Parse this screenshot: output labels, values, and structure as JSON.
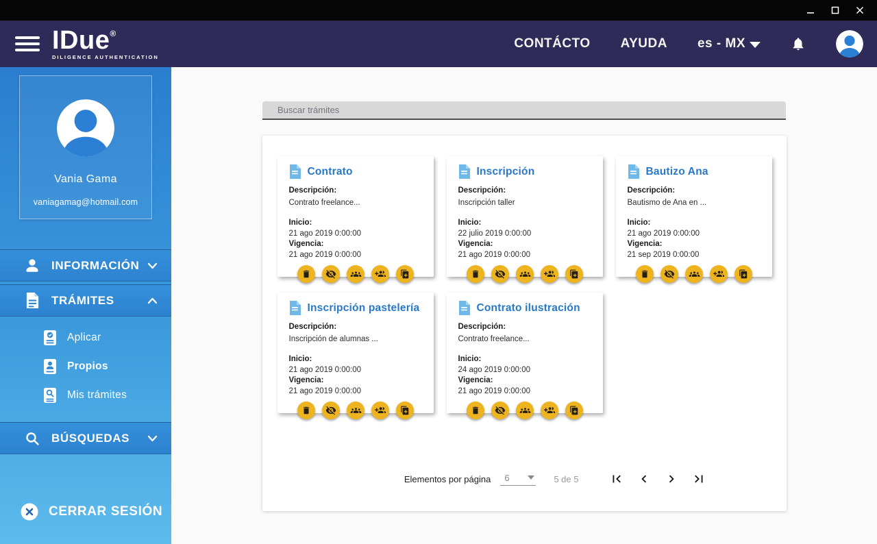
{
  "colors": {
    "accent_blue": "#2b7fd4",
    "header_bg": "#2e2b59",
    "sidebar_top": "#2b7ecf",
    "sidebar_bottom": "#5dbbec",
    "action_yellow": "#eeb420"
  },
  "window": {
    "controls": [
      "minimize",
      "maximize",
      "close"
    ]
  },
  "header": {
    "logo": {
      "title": "IDue",
      "registered": "®",
      "subtitle": "DILIGENCE AUTHENTICATION"
    },
    "nav": {
      "contact": "CONTÁCTO",
      "help": "AYUDA",
      "language": "es - MX"
    }
  },
  "sidebar": {
    "profile": {
      "name": "Vania Gama",
      "email": "vaniagamag@hotmail.com"
    },
    "sections": [
      {
        "label": "INFORMACIÓN",
        "state": "collapsed"
      },
      {
        "label": "TRÁMITES",
        "state": "expanded"
      },
      {
        "label": "BÚSQUEDAS",
        "state": "collapsed"
      }
    ],
    "tramites_items": [
      {
        "label": "Aplicar",
        "active": false
      },
      {
        "label": "Propios",
        "active": true
      },
      {
        "label": "Mis trámites",
        "active": false
      }
    ],
    "logout_label": "CERRAR SESIÓN"
  },
  "main": {
    "search_placeholder": "Buscar trámites",
    "card_labels": {
      "description": "Descripción:",
      "start": "Inicio:",
      "validity": "Vigencia:"
    },
    "card_actions": [
      "delete",
      "visibility-off",
      "groups",
      "person-add",
      "copy"
    ],
    "cards": [
      {
        "title": "Contrato",
        "description": "Contrato freelance...",
        "start": "21 ago 2019 0:00:00",
        "validity": "21 ago 2019 0:00:00"
      },
      {
        "title": "Inscripción",
        "description": "Inscripción taller",
        "start": "22 julio 2019 0:00:00",
        "validity": "21 ago 2019 0:00:00"
      },
      {
        "title": "Bautizo Ana",
        "description": "Bautismo de Ana en ...",
        "start": "21 ago 2019 0:00:00",
        "validity": "21 sep 2019 0:00:00"
      },
      {
        "title": "Inscripción pastelería",
        "description": "Inscripción de alumnas ...",
        "start": "21 ago 2019 0:00:00",
        "validity": "21 ago 2019 0:00:00"
      },
      {
        "title": "Contrato ilustración",
        "description": "Contrato freelance...",
        "start": "24 ago 2019 0:00:00",
        "validity": "21 ago 2019 0:00:00"
      }
    ],
    "pagination": {
      "items_per_page_label": "Elementos por página",
      "items_per_page": "6",
      "range": "5 de 5"
    }
  }
}
